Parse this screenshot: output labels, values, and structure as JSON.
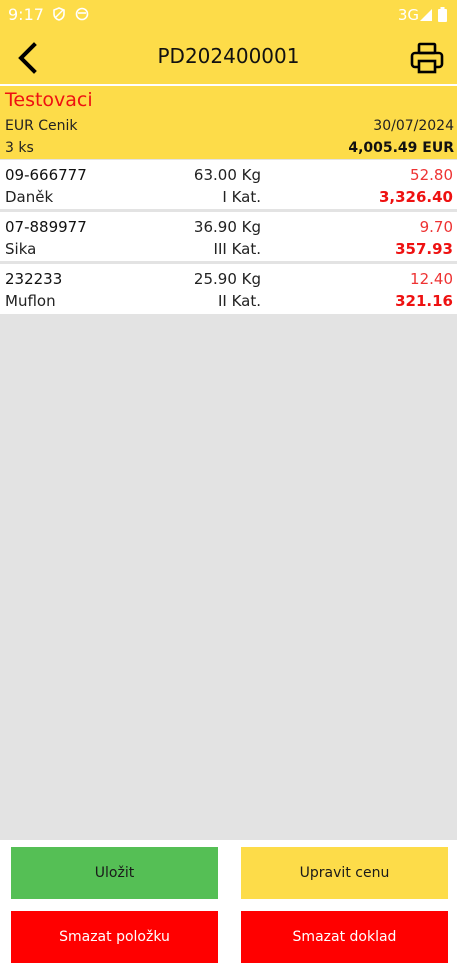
{
  "status_bar": {
    "time": "9:17",
    "network": "3G",
    "icons": [
      "vpn-shield-icon",
      "sync-icon",
      "signal-icon",
      "battery-icon"
    ]
  },
  "app_bar": {
    "title": "PD202400001",
    "back_icon": "back-arrow-icon",
    "print_icon": "printer-icon"
  },
  "document": {
    "name": "Testovaci",
    "pricelist": "EUR Cenik",
    "date": "30/07/2024",
    "count": "3 ks",
    "total": "4,005.49 EUR"
  },
  "items": [
    {
      "code": "09-666777",
      "name": "Daněk",
      "weight": "63.00 Kg",
      "class": "I Kat.",
      "unit_price": "52.80",
      "total": "3,326.40"
    },
    {
      "code": "07-889977",
      "name": "Sika",
      "weight": "36.90 Kg",
      "class": "III Kat.",
      "unit_price": "9.70",
      "total": "357.93"
    },
    {
      "code": "232233",
      "name": "Muflon",
      "weight": "25.90 Kg",
      "class": "II Kat.",
      "unit_price": "12.40",
      "total": "321.16"
    }
  ],
  "actions": {
    "save": "Uložit",
    "edit_price": "Upravit cenu",
    "delete_item": "Smazat položku",
    "delete_document": "Smazat doklad"
  },
  "colors": {
    "header_yellow": "#fddc49",
    "accent_red": "#ee1111",
    "save_green": "#55bf55",
    "delete_red": "#ff0000",
    "background_gray": "#e3e3e3"
  }
}
